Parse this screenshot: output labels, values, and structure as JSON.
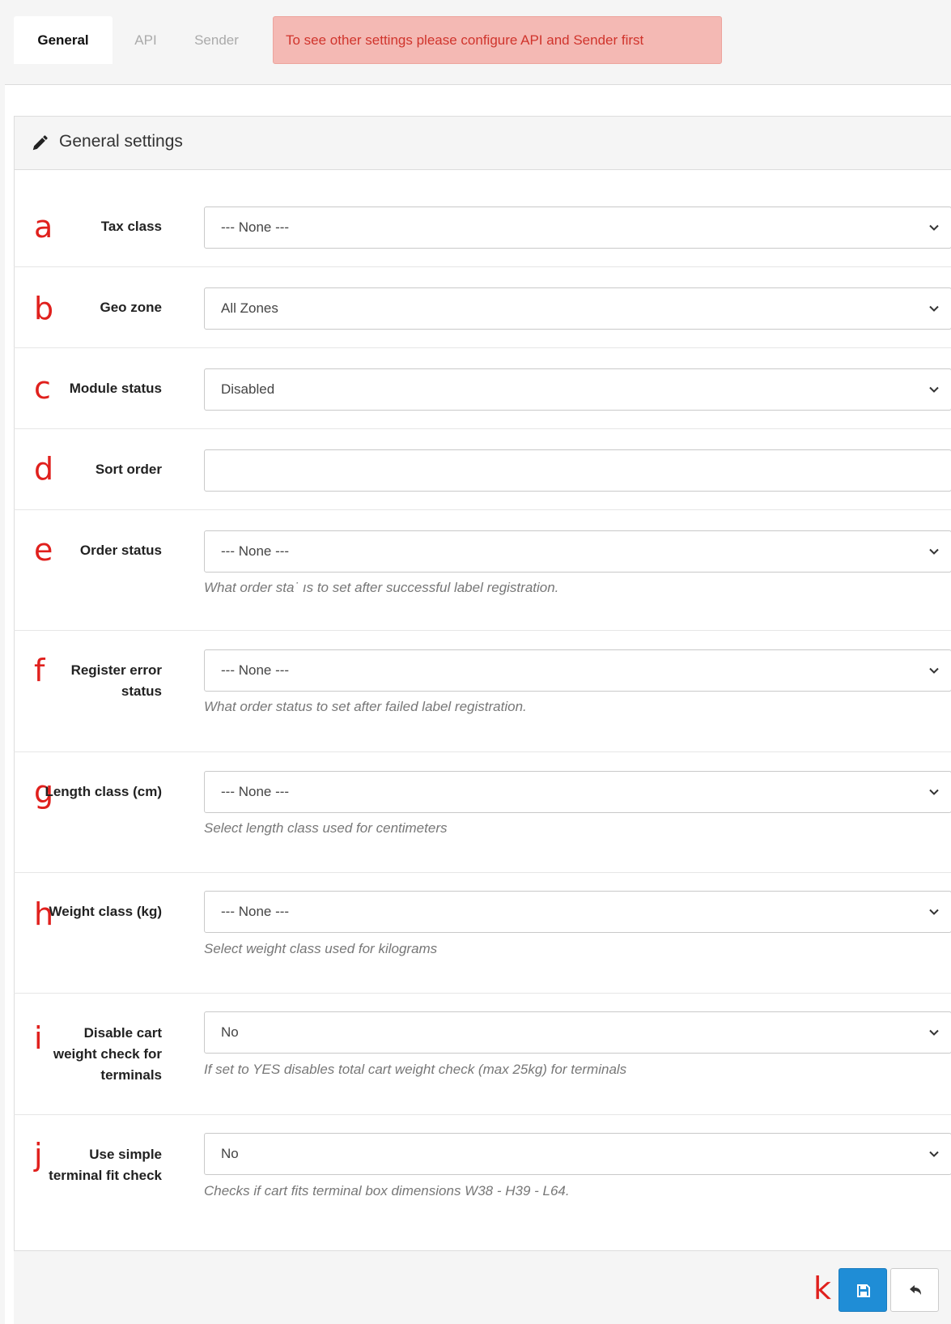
{
  "tabs": {
    "general": "General",
    "api": "API",
    "sender": "Sender",
    "alert": "To see other settings please configure API and Sender first"
  },
  "panel": {
    "title": "General settings"
  },
  "fields": {
    "tax_class": {
      "marker": "a",
      "label": "Tax class",
      "value": "--- None ---"
    },
    "geo_zone": {
      "marker": "b",
      "label": "Geo zone",
      "value": "All Zones"
    },
    "module_status": {
      "marker": "c",
      "label": "Module status",
      "value": "Disabled"
    },
    "sort_order": {
      "marker": "d",
      "label": "Sort order",
      "value": ""
    },
    "order_status": {
      "marker": "e",
      "label": "Order status",
      "value": "--- None ---",
      "help": "What order sta˙ ıs to set after successful label registration."
    },
    "register_error": {
      "marker": "f",
      "label": "Register error status",
      "value": "--- None ---",
      "help": "What order status to set after failed label registration."
    },
    "length_class": {
      "marker": "g",
      "label": "Length class (cm)",
      "value": "--- None ---",
      "help": "Select length class used for centimeters"
    },
    "weight_class": {
      "marker": "h",
      "label": "Weight class (kg)",
      "value": "--- None ---",
      "help": "Select weight class used for kilograms"
    },
    "disable_cart": {
      "marker": "i",
      "label": "Disable cart weight check for terminals",
      "value": "No",
      "help": "If set to YES disables total cart weight check (max 25kg) for terminals"
    },
    "simple_fit": {
      "marker": "j",
      "label": "Use simple terminal fit check",
      "value": "No",
      "help": "Checks if cart fits terminal box dimensions W38 - H39 - L64."
    }
  },
  "footer": {
    "marker": "k"
  },
  "icons": {
    "pencil": "pencil-icon",
    "chevron": "chevron-down-icon",
    "save": "save-icon",
    "back": "reply-icon"
  },
  "colors": {
    "primary": "#1f8dd6",
    "alert_bg": "#f4b9b4",
    "alert_text": "#d0342c",
    "marker": "#e0201d"
  }
}
